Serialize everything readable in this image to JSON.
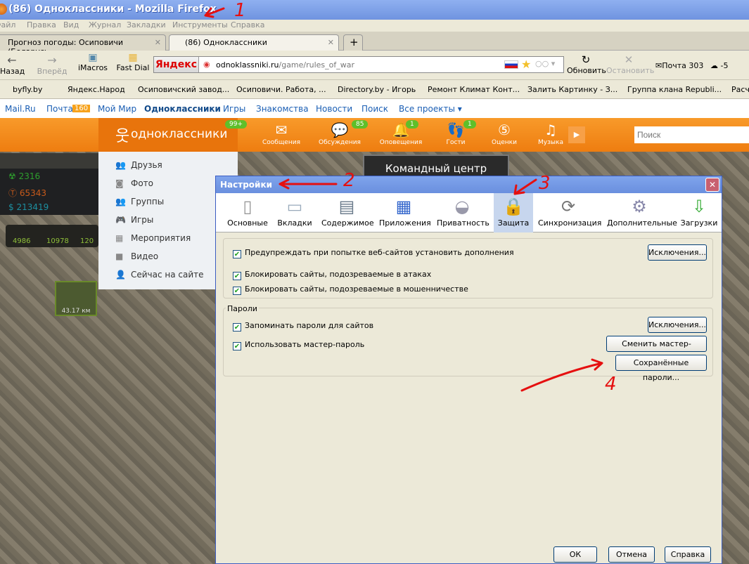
{
  "window": {
    "title": "(86) Одноклассники - Mozilla Firefox"
  },
  "menu": [
    "Файл",
    "Правка",
    "Вид",
    "Журнал",
    "Закладки",
    "Инструменты",
    "Справка"
  ],
  "tabs": [
    {
      "label": "Прогноз погоды: Осиповичи (Беларусь..."
    },
    {
      "label": "(86) Одноклассники"
    }
  ],
  "nav": {
    "back": "Назад",
    "forward": "Вперёд",
    "imacros": "iMacros",
    "fastdial": "Fast Dial",
    "yandex": "Яндекс",
    "url_domain": "odnoklassniki.ru",
    "url_path": "/game/rules_of_war",
    "reload": "Обновить",
    "stop": "Остановить",
    "mail": "Почта 303",
    "weather": "-5"
  },
  "bookmarks": [
    "byfly.by",
    "Яндекс.Народ",
    "Осиповичский завод...",
    "Осиповичи. Работа, ...",
    "Directory.by - Игорь",
    "Ремонт Климат Конт...",
    "Залить Картинку - З...",
    "Группа клана Republi...",
    "Расч"
  ],
  "mailru": {
    "items": [
      "Mail.Ru",
      "Почта",
      "Мой Мир",
      "Одноклассники",
      "Игры",
      "Знакомства",
      "Новости",
      "Поиск",
      "Все проекты ▾"
    ],
    "mail_badge": "160"
  },
  "ok": {
    "logo": "одноклассники",
    "logo_badge": "99+",
    "nav": [
      {
        "label": "Сообщения",
        "icon": "✉",
        "badge": ""
      },
      {
        "label": "Обсуждения",
        "icon": "💬",
        "badge": "85"
      },
      {
        "label": "Оповещения",
        "icon": "🔔",
        "badge": "1"
      },
      {
        "label": "Гости",
        "icon": "👣",
        "badge": "1"
      },
      {
        "label": "Оценки",
        "icon": "⑤",
        "badge": ""
      },
      {
        "label": "Музыка",
        "icon": "♫",
        "badge": ""
      }
    ],
    "search_placeholder": "Поиск"
  },
  "ok_menu": [
    "Друзья",
    "Фото",
    "Группы",
    "Игры",
    "Мероприятия",
    "Видео",
    "Сейчас на сайте"
  ],
  "game": {
    "res1": "2316",
    "res2": "65343",
    "res3": "213419",
    "s1": "4986",
    "s2": "10978",
    "s3": "120",
    "distance": "43.17 км",
    "command": "Командный центр"
  },
  "dialog": {
    "title": "Настройки",
    "tabs": [
      "Основные",
      "Вкладки",
      "Содержимое",
      "Приложения",
      "Приватность",
      "Защита",
      "Синхронизация",
      "Дополнительные",
      "Загрузки"
    ],
    "selected_tab": "Защита",
    "warn_addons": "Предупреждать при попытке веб-сайтов установить дополнения",
    "exceptions1": "Исключения...",
    "block_attack": "Блокировать сайты, подозреваемые в атаках",
    "block_fraud": "Блокировать сайты, подозреваемые в мошенничестве",
    "passwords_legend": "Пароли",
    "remember": "Запоминать пароли для сайтов",
    "exceptions2": "Исключения...",
    "use_master": "Использовать мастер-пароль",
    "change_master": "Сменить мастер-пароль...",
    "saved": "Сохранённые пароли...",
    "ok": "ОК",
    "cancel": "Отмена",
    "help": "Справка"
  },
  "annotations": [
    "1",
    "2",
    "3",
    "4"
  ]
}
